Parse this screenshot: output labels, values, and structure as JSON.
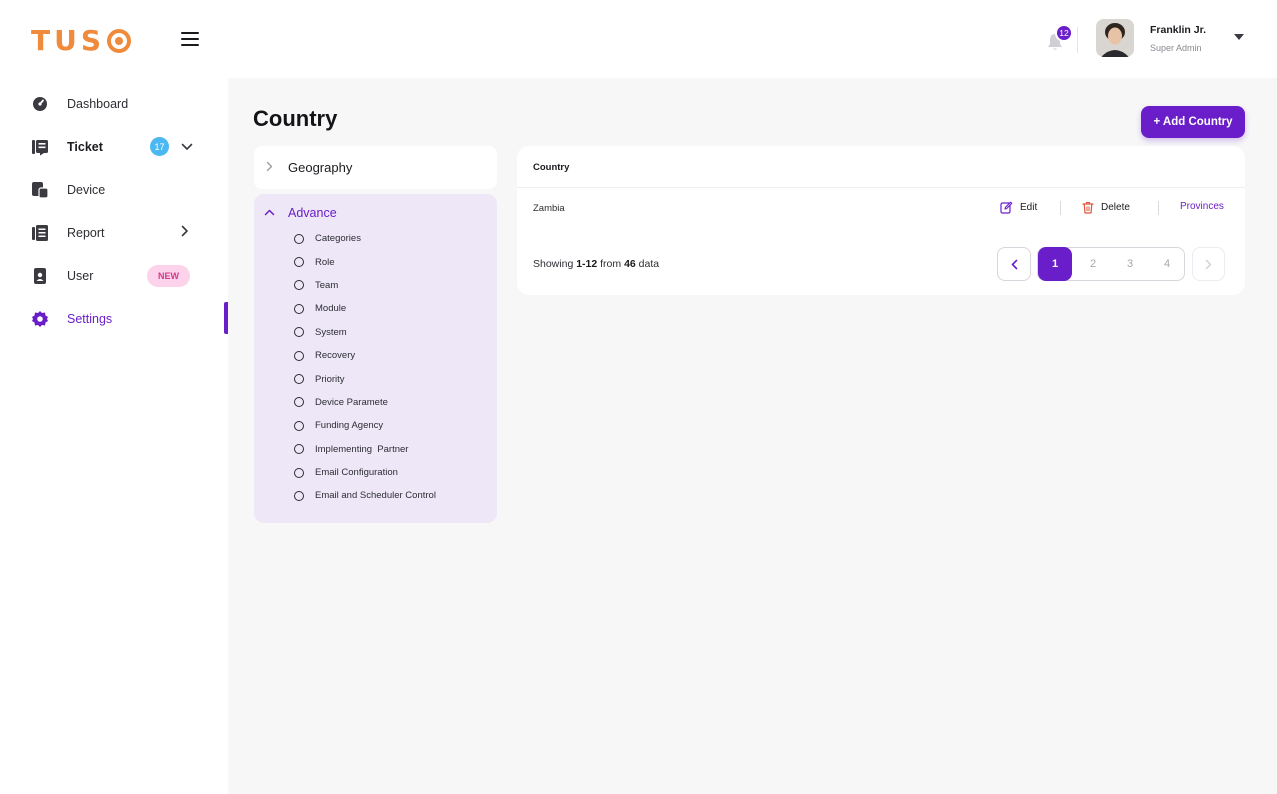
{
  "brand": {
    "logo_text": "TUS",
    "accent": "#6a1ec9",
    "logo_color": "#f08a3c"
  },
  "sidebar": {
    "items": [
      {
        "label": "Dashboard",
        "icon": "dashboard-icon"
      },
      {
        "label": "Ticket",
        "icon": "ticket-icon",
        "badge": "17",
        "chevron": "down"
      },
      {
        "label": "Device",
        "icon": "device-icon"
      },
      {
        "label": "Report",
        "icon": "report-icon",
        "chevron": "right"
      },
      {
        "label": "User",
        "icon": "user-icon",
        "badge": "NEW"
      },
      {
        "label": "Settings",
        "icon": "gear-icon",
        "active": true
      }
    ]
  },
  "header": {
    "notification_count": "12",
    "user_name": "Franklin Jr.",
    "user_role": "Super Admin"
  },
  "page": {
    "title": "Country",
    "add_button": "+ Add Country"
  },
  "settings_menu": {
    "geography_label": "Geography",
    "advance_label": "Advance",
    "advance_items": [
      "Categories",
      "Role",
      "Team",
      "Module",
      "System",
      "Recovery",
      "Priority",
      "Device Paramete",
      "Funding Agency",
      "Implementing  Partner",
      "Email Configuration",
      "Email and Scheduler Control"
    ]
  },
  "table": {
    "column_header": "Country",
    "rows": [
      {
        "country": "Zambia",
        "edit_label": "Edit",
        "delete_label": "Delete",
        "provinces_label": "Provinces"
      }
    ],
    "footer": {
      "prefix": "Showing ",
      "range": "1-12",
      "middle": " from ",
      "total": "46",
      "suffix": " data"
    },
    "pagination": {
      "pages": [
        "1",
        "2",
        "3",
        "4"
      ],
      "current": "1"
    }
  }
}
